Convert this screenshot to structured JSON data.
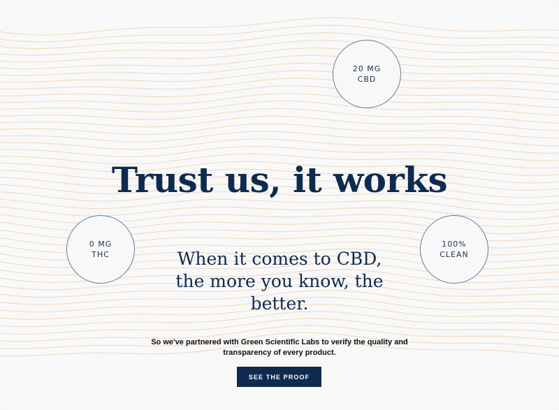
{
  "hero": {
    "headline": "Trust us, it works",
    "subhead": "When it comes to CBD, the more you know, the better.",
    "body": "So we've partnered with Green Scientific Labs to verify the quality and transparency of every product.",
    "cta_label": "SEE THE PROOF"
  },
  "badges": [
    {
      "line1": "20 MG",
      "line2": "CBD"
    },
    {
      "line1": "0 MG",
      "line2": "THC"
    },
    {
      "line1": "100%",
      "line2": "CLEAN"
    }
  ],
  "colors": {
    "navy": "#0f2a4f",
    "wave": "#efd2ad",
    "background": "#f8f8f9"
  }
}
